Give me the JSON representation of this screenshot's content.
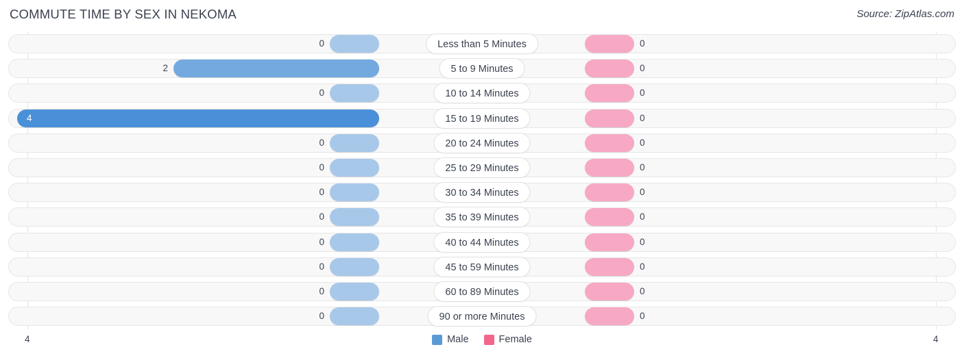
{
  "header": {
    "title": "COMMUTE TIME BY SEX IN NEKOMA",
    "source": "Source: ZipAtlas.com"
  },
  "axis": {
    "left_max": "4",
    "right_max": "4"
  },
  "legend": {
    "items": [
      {
        "label": "Male",
        "color": "#5b9bd5"
      },
      {
        "label": "Female",
        "color": "#f2668b"
      }
    ]
  },
  "colors": {
    "male_zero": "#a8c8ea",
    "male_mid": "#74a9e0",
    "male_max": "#4a90d9",
    "female_zero": "#f7a8c4",
    "track_bg": "#f8f8f8",
    "track_border": "#e6e6e6",
    "gridline": "#e4e4e4",
    "text": "#3b4250"
  },
  "chart_data": {
    "type": "bar",
    "title": "COMMUTE TIME BY SEX IN NEKOMA",
    "subtitle": "Source: ZipAtlas.com",
    "orientation": "horizontal-diverging",
    "xlabel": "",
    "ylabel": "",
    "xlim": [
      4,
      0,
      4
    ],
    "grid": true,
    "legend_position": "bottom-center",
    "categories": [
      "Less than 5 Minutes",
      "5 to 9 Minutes",
      "10 to 14 Minutes",
      "15 to 19 Minutes",
      "20 to 24 Minutes",
      "25 to 29 Minutes",
      "30 to 34 Minutes",
      "35 to 39 Minutes",
      "40 to 44 Minutes",
      "45 to 59 Minutes",
      "60 to 89 Minutes",
      "90 or more Minutes"
    ],
    "series": [
      {
        "name": "Male",
        "color": "#5b9bd5",
        "side": "left",
        "values": [
          0,
          2,
          0,
          4,
          0,
          0,
          0,
          0,
          0,
          0,
          0,
          0
        ]
      },
      {
        "name": "Female",
        "color": "#f2668b",
        "side": "right",
        "values": [
          0,
          0,
          0,
          0,
          0,
          0,
          0,
          0,
          0,
          0,
          0,
          0
        ]
      }
    ]
  },
  "rows": [
    {
      "label": "Less than 5 Minutes",
      "male": "0",
      "female": "0",
      "male_value": 0,
      "female_value": 0
    },
    {
      "label": "5 to 9 Minutes",
      "male": "2",
      "female": "0",
      "male_value": 2,
      "female_value": 0
    },
    {
      "label": "10 to 14 Minutes",
      "male": "0",
      "female": "0",
      "male_value": 0,
      "female_value": 0
    },
    {
      "label": "15 to 19 Minutes",
      "male": "4",
      "female": "0",
      "male_value": 4,
      "female_value": 0
    },
    {
      "label": "20 to 24 Minutes",
      "male": "0",
      "female": "0",
      "male_value": 0,
      "female_value": 0
    },
    {
      "label": "25 to 29 Minutes",
      "male": "0",
      "female": "0",
      "male_value": 0,
      "female_value": 0
    },
    {
      "label": "30 to 34 Minutes",
      "male": "0",
      "female": "0",
      "male_value": 0,
      "female_value": 0
    },
    {
      "label": "35 to 39 Minutes",
      "male": "0",
      "female": "0",
      "male_value": 0,
      "female_value": 0
    },
    {
      "label": "40 to 44 Minutes",
      "male": "0",
      "female": "0",
      "male_value": 0,
      "female_value": 0
    },
    {
      "label": "45 to 59 Minutes",
      "male": "0",
      "female": "0",
      "male_value": 0,
      "female_value": 0
    },
    {
      "label": "60 to 89 Minutes",
      "male": "0",
      "female": "0",
      "male_value": 0,
      "female_value": 0
    },
    {
      "label": "90 or more Minutes",
      "male": "0",
      "female": "0",
      "male_value": 0,
      "female_value": 0
    }
  ]
}
